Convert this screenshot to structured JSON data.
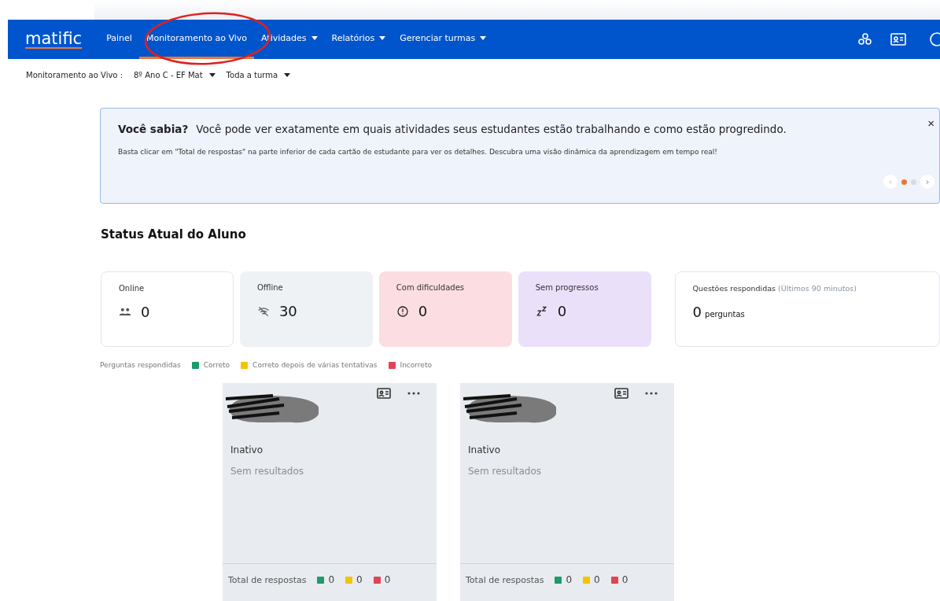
{
  "nav": {
    "logo": "matific",
    "items": [
      {
        "label": "Painel",
        "selected": false,
        "dropdown": false
      },
      {
        "label": "Monitoramento ao Vivo",
        "selected": true,
        "dropdown": false
      },
      {
        "label": "Atividades",
        "selected": false,
        "dropdown": true
      },
      {
        "label": "Relatórios",
        "selected": false,
        "dropdown": true
      },
      {
        "label": "Gerenciar turmas",
        "selected": false,
        "dropdown": true
      }
    ]
  },
  "subbar": {
    "label": "Monitoramento ao Vivo :",
    "class_select": "8º Ano C - EF Mat",
    "group_select": "Toda a turma"
  },
  "banner": {
    "title": "Você sabia?",
    "headline": "Você pode ver exatamente em quais atividades seus estudantes estão trabalhando e como estão progredindo.",
    "body": "Basta clicar em \"Total de respostas\" na parte inferior de cada cartão de estudante para ver os detalhes. Descubra uma visão dinâmica da aprendizagem em tempo real!",
    "close": "×",
    "pages": [
      {
        "selected": true
      },
      {
        "selected": false
      }
    ]
  },
  "heading": "Status Atual do Aluno",
  "stats": [
    {
      "kind": "online",
      "label": "Online",
      "value": "0"
    },
    {
      "kind": "offline",
      "label": "Offline",
      "value": "30"
    },
    {
      "kind": "struggling",
      "label": "Com dificuldades",
      "value": "0"
    },
    {
      "kind": "idle",
      "label": "Sem progressos",
      "value": "0"
    }
  ],
  "questions": {
    "label": "Questões respondidas",
    "note": "(Últimos 90 minutos)",
    "value": "0",
    "unit": "perguntas"
  },
  "legend": {
    "label": "Perguntas respondidas",
    "items": [
      {
        "label": "Correto",
        "color": "#1a9c6b"
      },
      {
        "label": "Correto depois de várias tentativas",
        "color": "#f5c400"
      },
      {
        "label": "Incorreto",
        "color": "#e04556"
      }
    ]
  },
  "students": [
    {
      "status": "Inativo",
      "result": "Sem resultados",
      "total_label": "Total de respostas",
      "counts": [
        {
          "value": "0",
          "color": "#1a9c6b"
        },
        {
          "value": "0",
          "color": "#f5c400"
        },
        {
          "value": "0",
          "color": "#e04556"
        }
      ]
    },
    {
      "status": "Inativo",
      "result": "Sem resultados",
      "total_label": "Total de respostas",
      "counts": [
        {
          "value": "0",
          "color": "#1a9c6b"
        },
        {
          "value": "0",
          "color": "#f5c400"
        },
        {
          "value": "0",
          "color": "#e04556"
        }
      ]
    }
  ]
}
